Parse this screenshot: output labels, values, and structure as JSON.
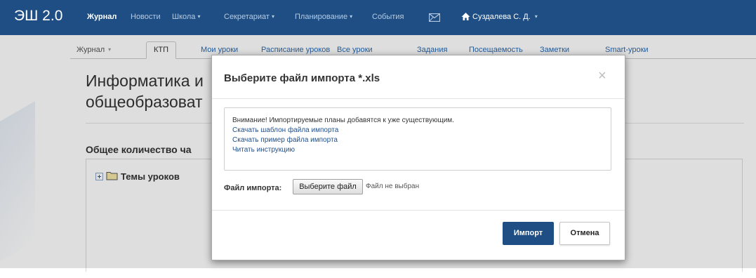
{
  "navbar": {
    "brand": "ЭШ 2.0",
    "items": [
      {
        "label": "Журнал",
        "active": true,
        "dropdown": false
      },
      {
        "label": "Новости",
        "active": false,
        "dropdown": false
      },
      {
        "label": "Школа",
        "active": false,
        "dropdown": true
      },
      {
        "label": "Секретариат",
        "active": false,
        "dropdown": true
      },
      {
        "label": "Планирование",
        "active": false,
        "dropdown": true
      },
      {
        "label": "События",
        "active": false,
        "dropdown": false
      }
    ],
    "mail_icon": "envelope-icon",
    "home_icon": "home-icon",
    "user": "Суздалева С. Д.",
    "caret": "▾"
  },
  "subnav": {
    "tabs": [
      {
        "label": "Журнал"
      },
      {
        "label": "КТП"
      },
      {
        "label": "Мои уроки"
      },
      {
        "label": "Расписание уроков"
      },
      {
        "label": "Все уроки"
      },
      {
        "label": "Задания"
      },
      {
        "label": "Посещаемость"
      },
      {
        "label": "Заметки"
      },
      {
        "label": "Smart-уроки"
      }
    ]
  },
  "page": {
    "title_line1": "Информатика и",
    "title_line2": "общеобразоват",
    "total_hours": "Общее количество ча",
    "tree_label": "Темы уроков"
  },
  "modal": {
    "title": "Выберите файл импорта *.xls",
    "close": "×",
    "notice": "Внимание! Импортируемые планы добавятся к уже существующим.",
    "links": [
      "Скачать шаблон файла импорта",
      "Скачать пример файла импорта",
      "Читать инструкцию"
    ],
    "file_label": "Файл импорта:",
    "file_button": "Выберите файл",
    "file_status": "Файл не выбран",
    "import_button": "Импорт",
    "cancel_button": "Отмена"
  },
  "colors": {
    "navbar_bg": "#1e4e83",
    "primary_button": "#1e4e83",
    "link": "#1f4f8c"
  }
}
